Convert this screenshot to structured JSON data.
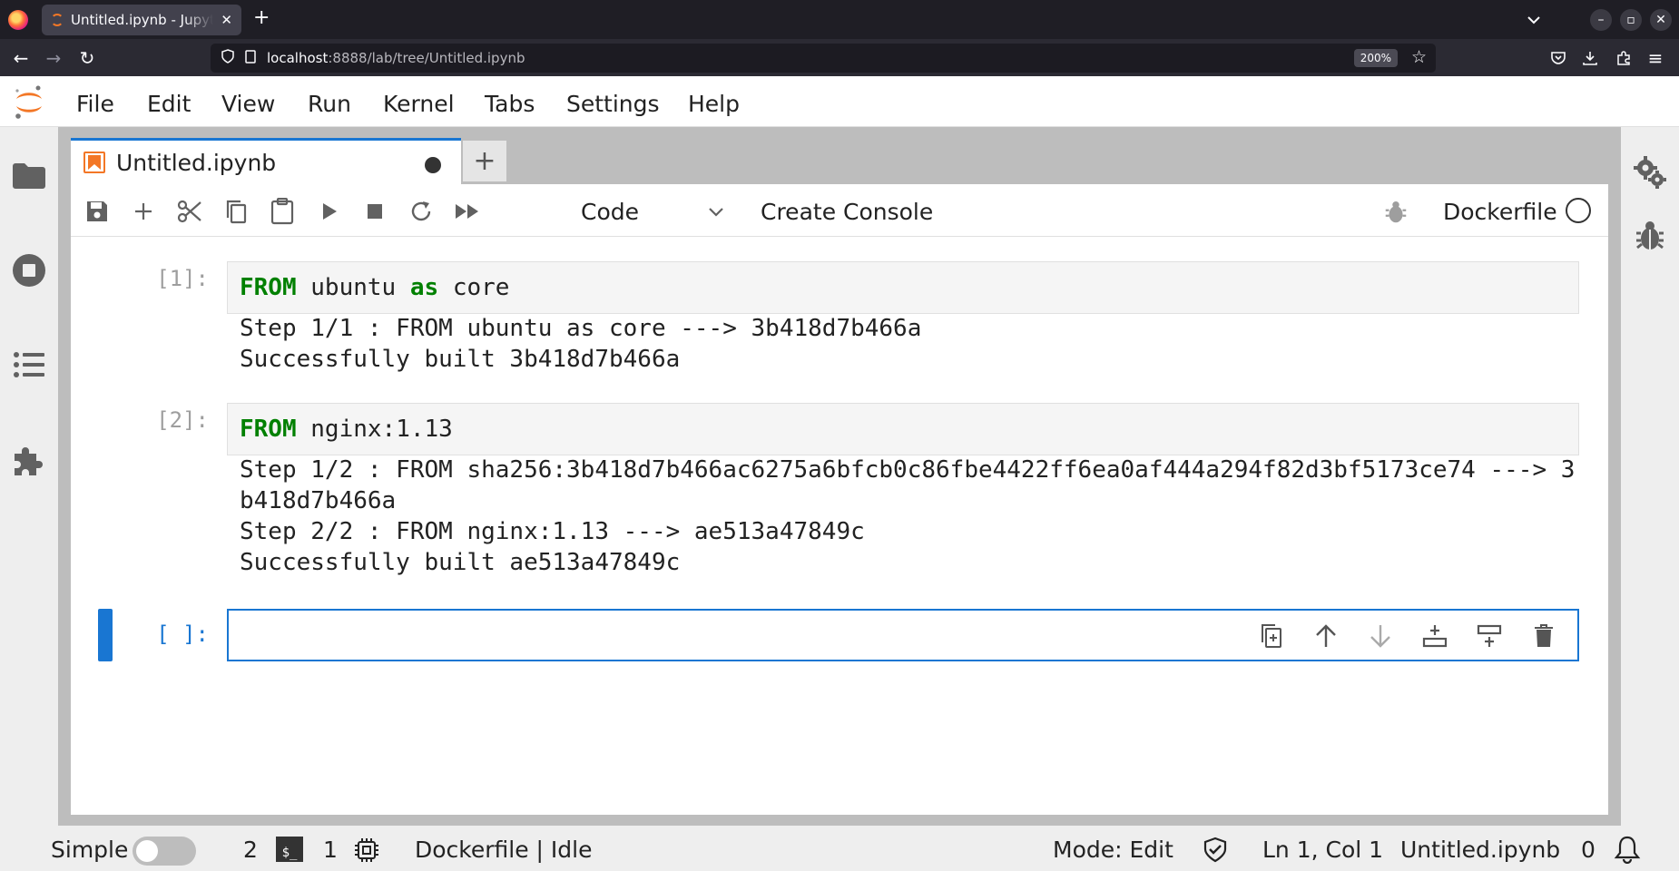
{
  "browser": {
    "tab_title": "Untitled.ipynb - JupyterLab",
    "url_host": "localhost",
    "url_path": ":8888/lab/tree/Untitled.ipynb",
    "zoom": "200%"
  },
  "menu": {
    "items": [
      "File",
      "Edit",
      "View",
      "Run",
      "Kernel",
      "Tabs",
      "Settings",
      "Help"
    ]
  },
  "notebook": {
    "tab_title": "Untitled.ipynb",
    "cell_type": "Code",
    "create_console": "Create Console",
    "kernel_name": "Dockerfile"
  },
  "cells": [
    {
      "prompt": "[1]:",
      "code_kw": "FROM",
      "code_rest": " ubuntu ",
      "code_kw2": "as",
      "code_rest2": " core",
      "output": "Step 1/1 : FROM ubuntu as core ---> 3b418d7b466a\nSuccessfully built 3b418d7b466a"
    },
    {
      "prompt": "[2]:",
      "code_kw": "FROM",
      "code_rest": " nginx:1.13",
      "output": "Step 1/2 : FROM sha256:3b418d7b466ac6275a6bfcb0c86fbe4422ff6ea0af444a294f82d3bf5173ce74 ---> 3\nb418d7b466a\nStep 2/2 : FROM nginx:1.13 ---> ae513a47849c\nSuccessfully built ae513a47849c"
    },
    {
      "prompt": "[ ]:",
      "code": ""
    }
  ],
  "statusbar": {
    "mode_label": "Simple",
    "terminals_count": "2",
    "kernels_count": "1",
    "kernel_status": "Dockerfile | Idle",
    "edit_mode": "Mode: Edit",
    "cursor": "Ln 1, Col 1",
    "filename": "Untitled.ipynb",
    "notifications": "0"
  },
  "colors": {
    "accent": "#1976d2",
    "keyword": "#008000",
    "jupyter_orange": "#f37726"
  }
}
